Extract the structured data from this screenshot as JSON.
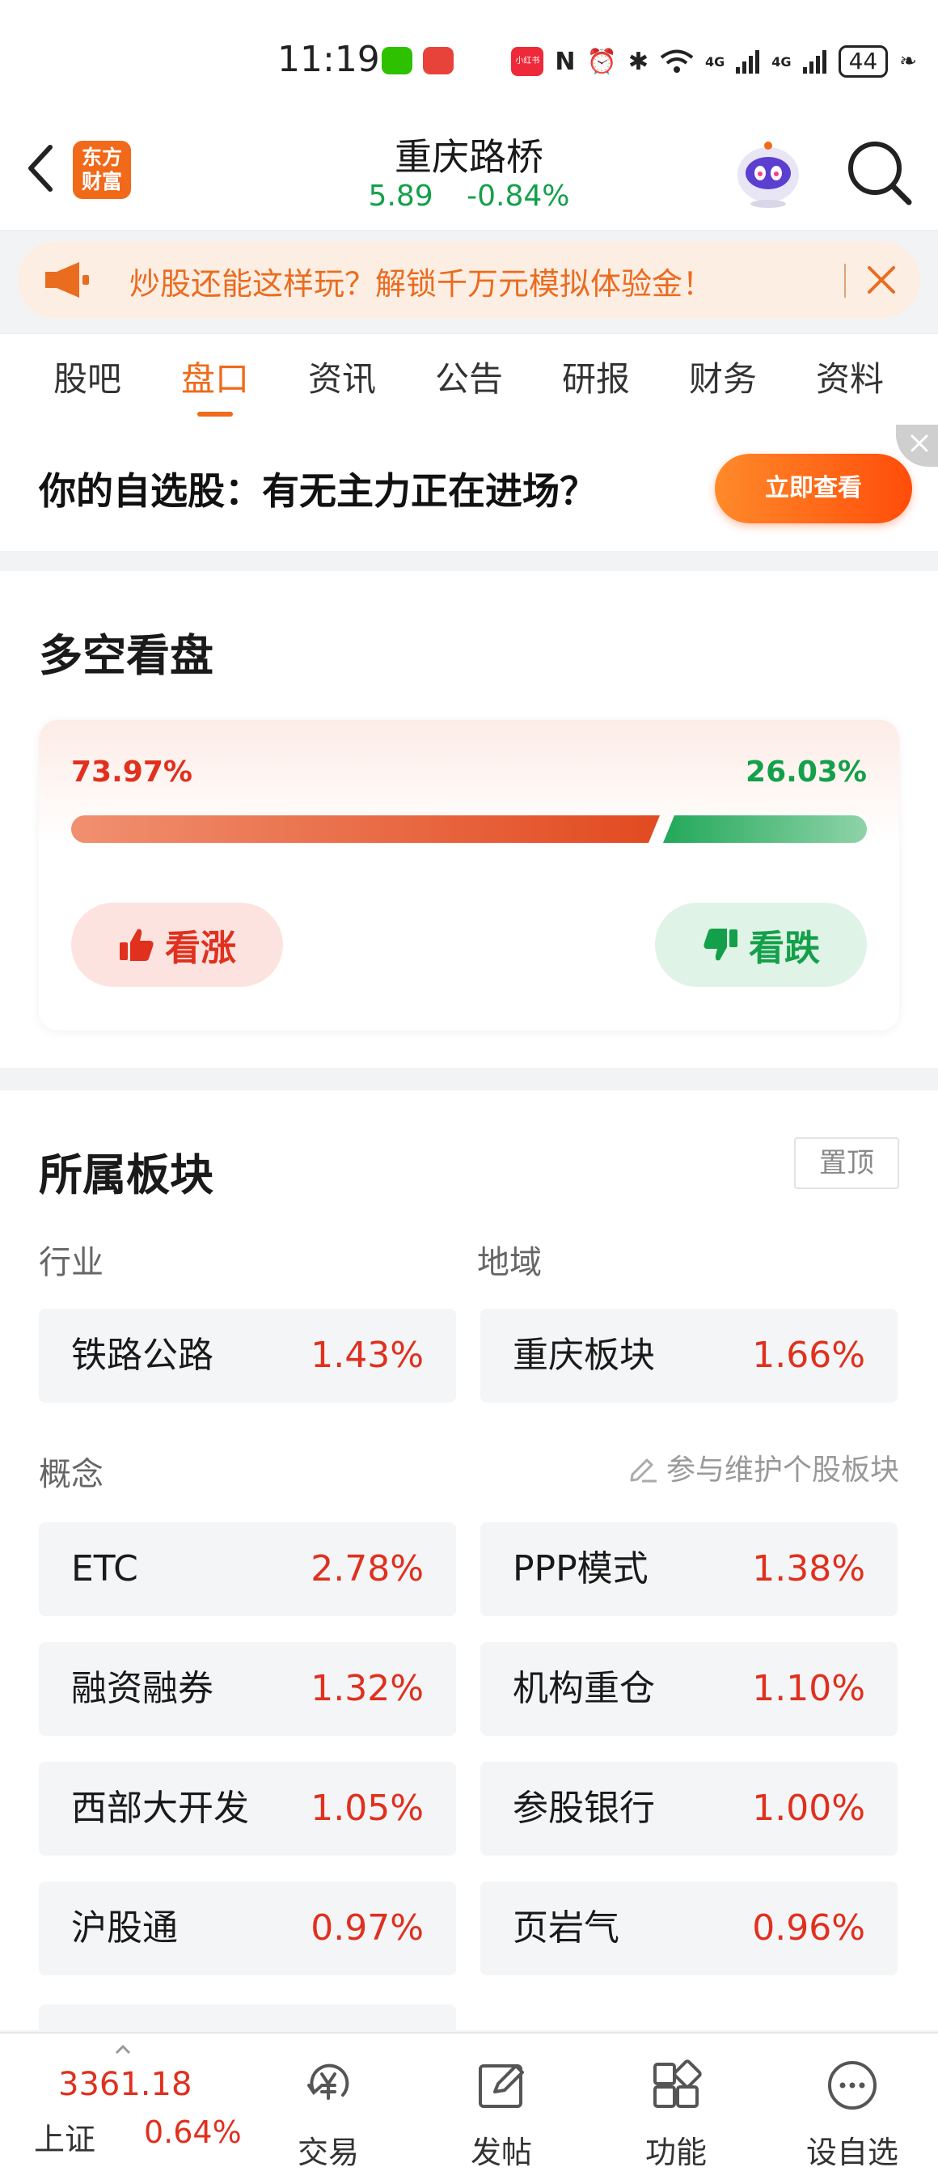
{
  "status_bar": {
    "time": "11:19",
    "battery": "44",
    "nfc": "N",
    "signal_1": "4G",
    "signal_2": "4G",
    "xiaohongshu": "小红书"
  },
  "header": {
    "logo_text": "东方财富",
    "stock_name": "重庆路桥",
    "price": "5.89",
    "change_pct": "-0.84%"
  },
  "banner": {
    "text": "炒股还能这样玩？解锁千万元模拟体验金！"
  },
  "tabs": [
    {
      "label": "股吧"
    },
    {
      "label": "盘口"
    },
    {
      "label": "资讯"
    },
    {
      "label": "公告"
    },
    {
      "label": "研报"
    },
    {
      "label": "财务"
    },
    {
      "label": "资料"
    }
  ],
  "promo": {
    "text": "你的自选股：有无主力正在进场？",
    "button": "立即查看"
  },
  "sentiment": {
    "title": "多空看盘",
    "bull_pct_label": "73.97%",
    "bear_pct_label": "26.03%",
    "bull_ratio": 0.7397,
    "bull_button": "看涨",
    "bear_button": "看跌"
  },
  "sectors": {
    "title": "所属板块",
    "pin_button": "置顶",
    "industry_label": "行业",
    "region_label": "地域",
    "concept_label": "概念",
    "maintain_link": "参与维护个股板块",
    "industry": {
      "name": "铁路公路",
      "pct": "1.43%"
    },
    "region": {
      "name": "重庆板块",
      "pct": "1.66%"
    },
    "concepts": [
      {
        "name": "ETC",
        "pct": "2.78%"
      },
      {
        "name": "PPP模式",
        "pct": "1.38%"
      },
      {
        "name": "融资融券",
        "pct": "1.32%"
      },
      {
        "name": "机构重仓",
        "pct": "1.10%"
      },
      {
        "name": "西部大开发",
        "pct": "1.05%"
      },
      {
        "name": "参股银行",
        "pct": "1.00%"
      },
      {
        "name": "沪股通",
        "pct": "0.97%"
      },
      {
        "name": "页岩气",
        "pct": "0.96%"
      }
    ]
  },
  "bottom_bar": {
    "index_value": "3361.18",
    "index_name": "上证",
    "index_change": "0.64%",
    "items": [
      {
        "label": "交易"
      },
      {
        "label": "发帖"
      },
      {
        "label": "功能"
      },
      {
        "label": "设自选"
      }
    ]
  }
}
